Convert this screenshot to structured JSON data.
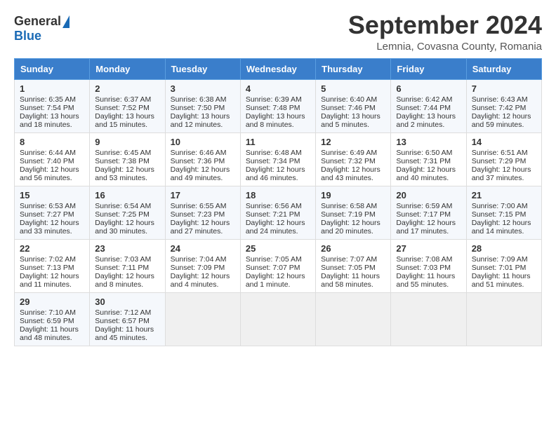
{
  "logo": {
    "general": "General",
    "blue": "Blue"
  },
  "title": "September 2024",
  "subtitle": "Lemnia, Covasna County, Romania",
  "headers": [
    "Sunday",
    "Monday",
    "Tuesday",
    "Wednesday",
    "Thursday",
    "Friday",
    "Saturday"
  ],
  "weeks": [
    [
      {
        "day": "1",
        "sunrise": "Sunrise: 6:35 AM",
        "sunset": "Sunset: 7:54 PM",
        "daylight": "Daylight: 13 hours and 18 minutes."
      },
      {
        "day": "2",
        "sunrise": "Sunrise: 6:37 AM",
        "sunset": "Sunset: 7:52 PM",
        "daylight": "Daylight: 13 hours and 15 minutes."
      },
      {
        "day": "3",
        "sunrise": "Sunrise: 6:38 AM",
        "sunset": "Sunset: 7:50 PM",
        "daylight": "Daylight: 13 hours and 12 minutes."
      },
      {
        "day": "4",
        "sunrise": "Sunrise: 6:39 AM",
        "sunset": "Sunset: 7:48 PM",
        "daylight": "Daylight: 13 hours and 8 minutes."
      },
      {
        "day": "5",
        "sunrise": "Sunrise: 6:40 AM",
        "sunset": "Sunset: 7:46 PM",
        "daylight": "Daylight: 13 hours and 5 minutes."
      },
      {
        "day": "6",
        "sunrise": "Sunrise: 6:42 AM",
        "sunset": "Sunset: 7:44 PM",
        "daylight": "Daylight: 13 hours and 2 minutes."
      },
      {
        "day": "7",
        "sunrise": "Sunrise: 6:43 AM",
        "sunset": "Sunset: 7:42 PM",
        "daylight": "Daylight: 12 hours and 59 minutes."
      }
    ],
    [
      {
        "day": "8",
        "sunrise": "Sunrise: 6:44 AM",
        "sunset": "Sunset: 7:40 PM",
        "daylight": "Daylight: 12 hours and 56 minutes."
      },
      {
        "day": "9",
        "sunrise": "Sunrise: 6:45 AM",
        "sunset": "Sunset: 7:38 PM",
        "daylight": "Daylight: 12 hours and 53 minutes."
      },
      {
        "day": "10",
        "sunrise": "Sunrise: 6:46 AM",
        "sunset": "Sunset: 7:36 PM",
        "daylight": "Daylight: 12 hours and 49 minutes."
      },
      {
        "day": "11",
        "sunrise": "Sunrise: 6:48 AM",
        "sunset": "Sunset: 7:34 PM",
        "daylight": "Daylight: 12 hours and 46 minutes."
      },
      {
        "day": "12",
        "sunrise": "Sunrise: 6:49 AM",
        "sunset": "Sunset: 7:32 PM",
        "daylight": "Daylight: 12 hours and 43 minutes."
      },
      {
        "day": "13",
        "sunrise": "Sunrise: 6:50 AM",
        "sunset": "Sunset: 7:31 PM",
        "daylight": "Daylight: 12 hours and 40 minutes."
      },
      {
        "day": "14",
        "sunrise": "Sunrise: 6:51 AM",
        "sunset": "Sunset: 7:29 PM",
        "daylight": "Daylight: 12 hours and 37 minutes."
      }
    ],
    [
      {
        "day": "15",
        "sunrise": "Sunrise: 6:53 AM",
        "sunset": "Sunset: 7:27 PM",
        "daylight": "Daylight: 12 hours and 33 minutes."
      },
      {
        "day": "16",
        "sunrise": "Sunrise: 6:54 AM",
        "sunset": "Sunset: 7:25 PM",
        "daylight": "Daylight: 12 hours and 30 minutes."
      },
      {
        "day": "17",
        "sunrise": "Sunrise: 6:55 AM",
        "sunset": "Sunset: 7:23 PM",
        "daylight": "Daylight: 12 hours and 27 minutes."
      },
      {
        "day": "18",
        "sunrise": "Sunrise: 6:56 AM",
        "sunset": "Sunset: 7:21 PM",
        "daylight": "Daylight: 12 hours and 24 minutes."
      },
      {
        "day": "19",
        "sunrise": "Sunrise: 6:58 AM",
        "sunset": "Sunset: 7:19 PM",
        "daylight": "Daylight: 12 hours and 20 minutes."
      },
      {
        "day": "20",
        "sunrise": "Sunrise: 6:59 AM",
        "sunset": "Sunset: 7:17 PM",
        "daylight": "Daylight: 12 hours and 17 minutes."
      },
      {
        "day": "21",
        "sunrise": "Sunrise: 7:00 AM",
        "sunset": "Sunset: 7:15 PM",
        "daylight": "Daylight: 12 hours and 14 minutes."
      }
    ],
    [
      {
        "day": "22",
        "sunrise": "Sunrise: 7:02 AM",
        "sunset": "Sunset: 7:13 PM",
        "daylight": "Daylight: 12 hours and 11 minutes."
      },
      {
        "day": "23",
        "sunrise": "Sunrise: 7:03 AM",
        "sunset": "Sunset: 7:11 PM",
        "daylight": "Daylight: 12 hours and 8 minutes."
      },
      {
        "day": "24",
        "sunrise": "Sunrise: 7:04 AM",
        "sunset": "Sunset: 7:09 PM",
        "daylight": "Daylight: 12 hours and 4 minutes."
      },
      {
        "day": "25",
        "sunrise": "Sunrise: 7:05 AM",
        "sunset": "Sunset: 7:07 PM",
        "daylight": "Daylight: 12 hours and 1 minute."
      },
      {
        "day": "26",
        "sunrise": "Sunrise: 7:07 AM",
        "sunset": "Sunset: 7:05 PM",
        "daylight": "Daylight: 11 hours and 58 minutes."
      },
      {
        "day": "27",
        "sunrise": "Sunrise: 7:08 AM",
        "sunset": "Sunset: 7:03 PM",
        "daylight": "Daylight: 11 hours and 55 minutes."
      },
      {
        "day": "28",
        "sunrise": "Sunrise: 7:09 AM",
        "sunset": "Sunset: 7:01 PM",
        "daylight": "Daylight: 11 hours and 51 minutes."
      }
    ],
    [
      {
        "day": "29",
        "sunrise": "Sunrise: 7:10 AM",
        "sunset": "Sunset: 6:59 PM",
        "daylight": "Daylight: 11 hours and 48 minutes."
      },
      {
        "day": "30",
        "sunrise": "Sunrise: 7:12 AM",
        "sunset": "Sunset: 6:57 PM",
        "daylight": "Daylight: 11 hours and 45 minutes."
      },
      null,
      null,
      null,
      null,
      null
    ]
  ]
}
